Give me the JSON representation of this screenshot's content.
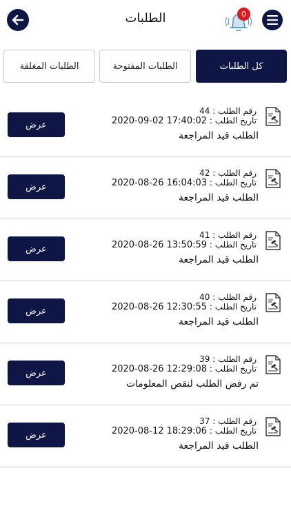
{
  "header": {
    "title": "الطلبات",
    "notification_count": "0"
  },
  "tabs": [
    {
      "label": "كل الطلبات",
      "active": true
    },
    {
      "label": "الطلبات المفتوحة",
      "active": false
    },
    {
      "label": "الطلبات المغلقة",
      "active": false
    }
  ],
  "labels": {
    "request_number": "رقم الطلب :",
    "request_date": "تاريخ الطلب :",
    "view": "عرض"
  },
  "requests": [
    {
      "number": "44",
      "date": "2020-09-02 17:40:02",
      "status": "الطلب قيد المراجعة"
    },
    {
      "number": "42",
      "date": "2020-08-26 16:04:03",
      "status": "الطلب قيد المراجعة"
    },
    {
      "number": "41",
      "date": "2020-08-26 13:50:59",
      "status": "الطلب قيد المراجعة"
    },
    {
      "number": "40",
      "date": "2020-08-26 12:30:55",
      "status": "الطلب قيد المراجعة"
    },
    {
      "number": "39",
      "date": "2020-08-26 12:29:08",
      "status": "تم رفض الطلب لنقص المعلومات"
    },
    {
      "number": "37",
      "date": "2020-08-12 18:29:06",
      "status": "الطلب قيد المراجعة"
    }
  ],
  "colors": {
    "primary": "#0d1645",
    "badge": "#e0171f",
    "bell": "#4a90c8",
    "divider": "#cfcfcf"
  }
}
